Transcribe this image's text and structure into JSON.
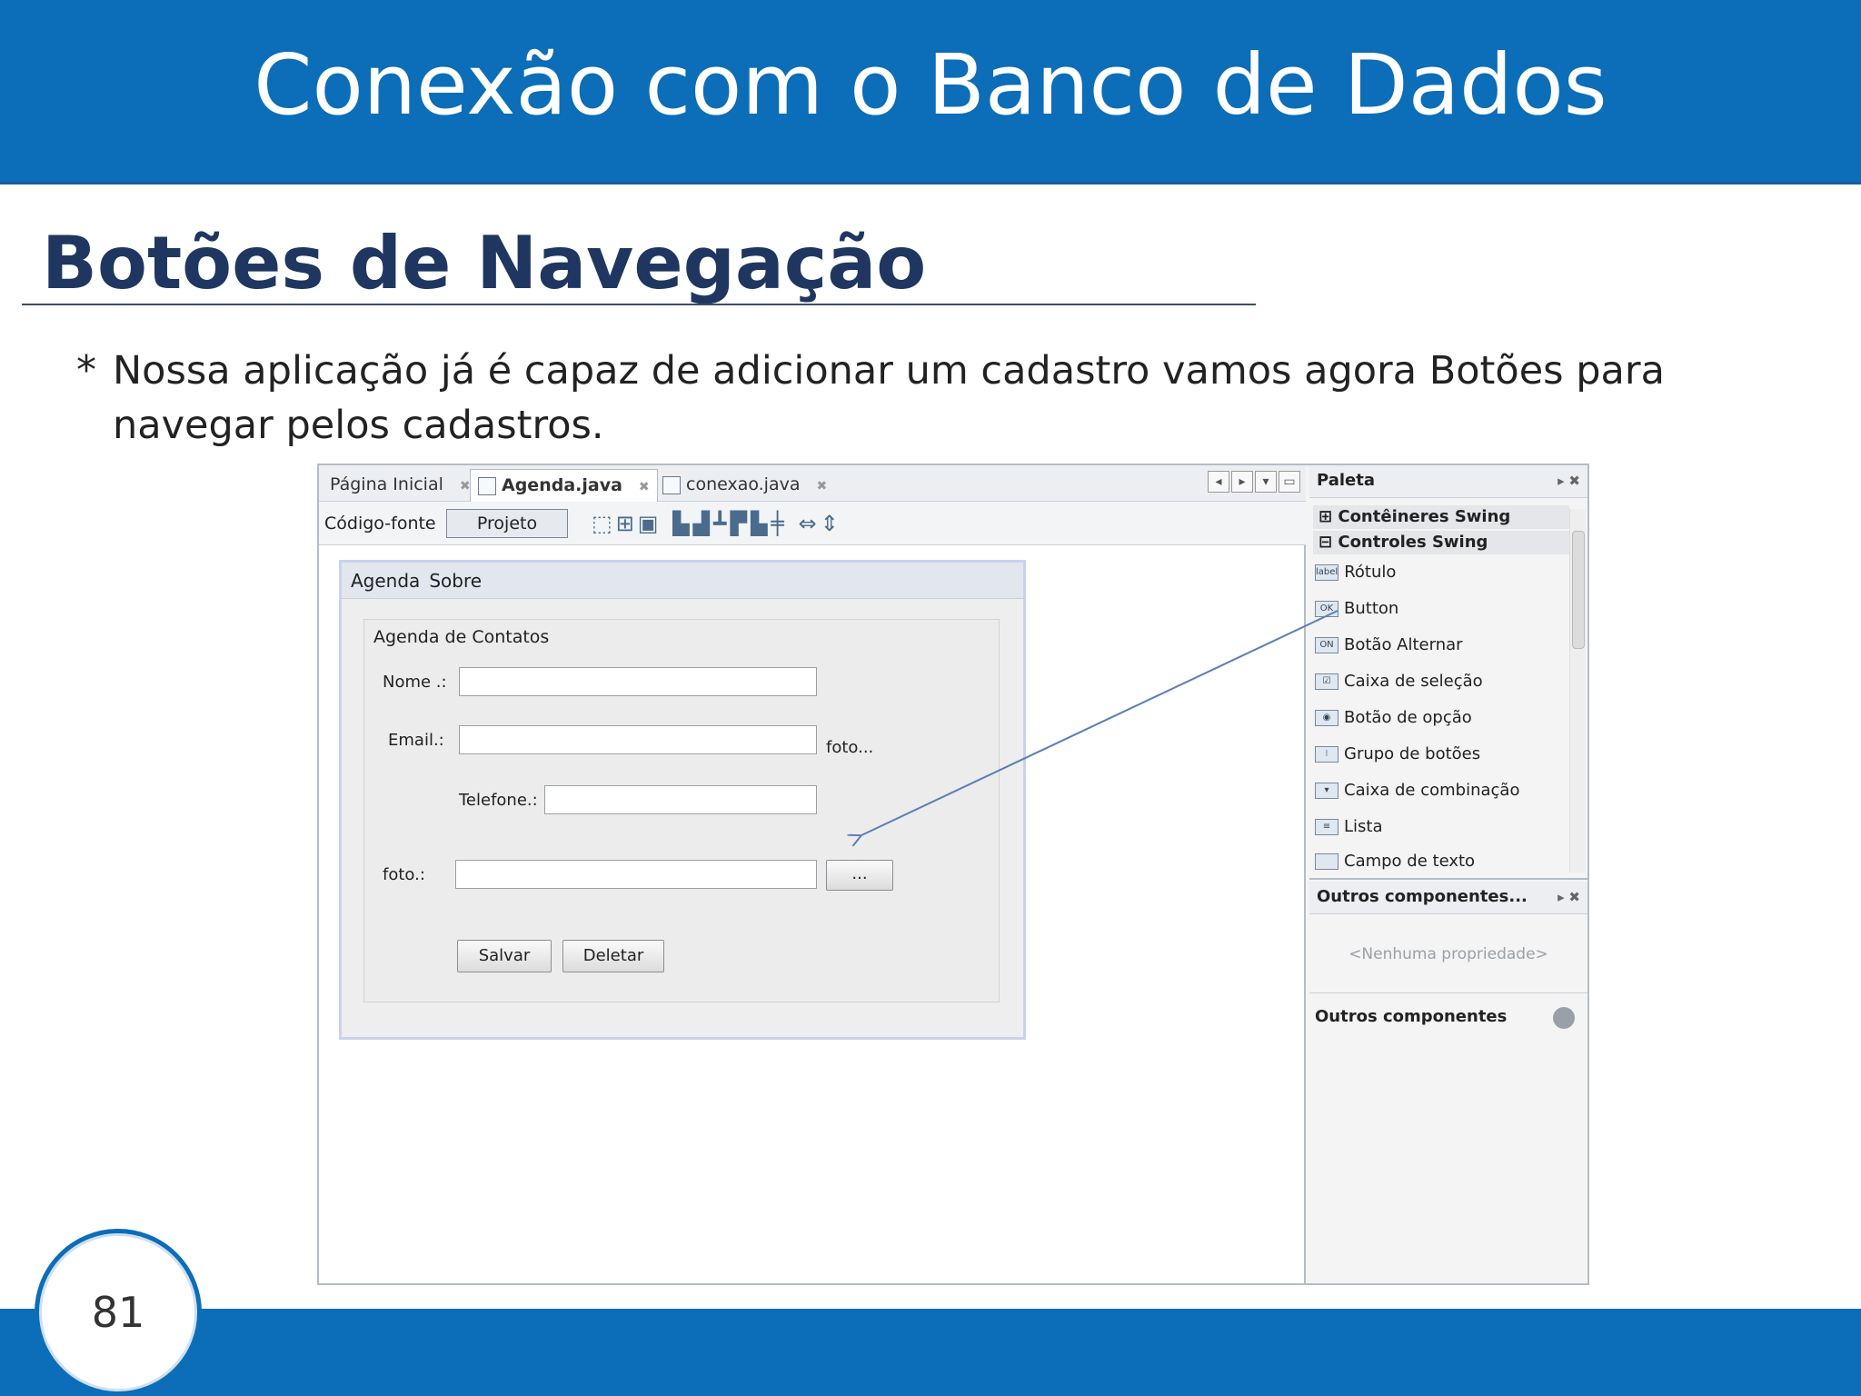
{
  "slide": {
    "title": "Conexão com o Banco de Dados",
    "section_title": "Botões de Navegação",
    "bullet_marker": "*",
    "bullet_text": "Nossa aplicação já é capaz de adicionar um cadastro vamos agora Botões para navegar pelos cadastros.",
    "page_number": "81"
  },
  "ide": {
    "tabs": [
      {
        "label": "Página Inicial"
      },
      {
        "label": "Agenda.java"
      },
      {
        "label": "conexao.java"
      }
    ],
    "toolbar": {
      "source_label": "Código-fonte",
      "design_label": "Projeto"
    },
    "form": {
      "menu": [
        "Agenda",
        "Sobre"
      ],
      "panel_title": "Agenda de Contatos",
      "labels": {
        "nome": "Nome .:",
        "email": "Email.:",
        "foto_link": "foto...",
        "telefone": "Telefone.:",
        "foto": "foto.:"
      },
      "browse_button": "...",
      "save_button": "Salvar",
      "delete_button": "Deletar"
    },
    "palette": {
      "title": "Paleta",
      "categories": [
        "Contêineres Swing",
        "Controles Swing"
      ],
      "items": [
        {
          "icon": "label",
          "label": "Rótulo"
        },
        {
          "icon": "OK",
          "label": "Button"
        },
        {
          "icon": "ON",
          "label": "Botão Alternar"
        },
        {
          "icon": "☑",
          "label": "Caixa de seleção"
        },
        {
          "icon": "◉",
          "label": "Botão de opção"
        },
        {
          "icon": "⁝",
          "label": "Grupo de botões"
        },
        {
          "icon": "▾",
          "label": "Caixa de combinação"
        },
        {
          "icon": "≡",
          "label": "Lista"
        },
        {
          "icon": "",
          "label": "Campo de texto"
        }
      ]
    },
    "inspector": {
      "title": "Outros componentes...",
      "empty_text": "<Nenhuma propriedade>",
      "section_label": "Outros componentes"
    }
  },
  "colors": {
    "brand_blue": "#0c6db8",
    "section_title": "#1f3760",
    "arrow": "#5a7fb5"
  }
}
